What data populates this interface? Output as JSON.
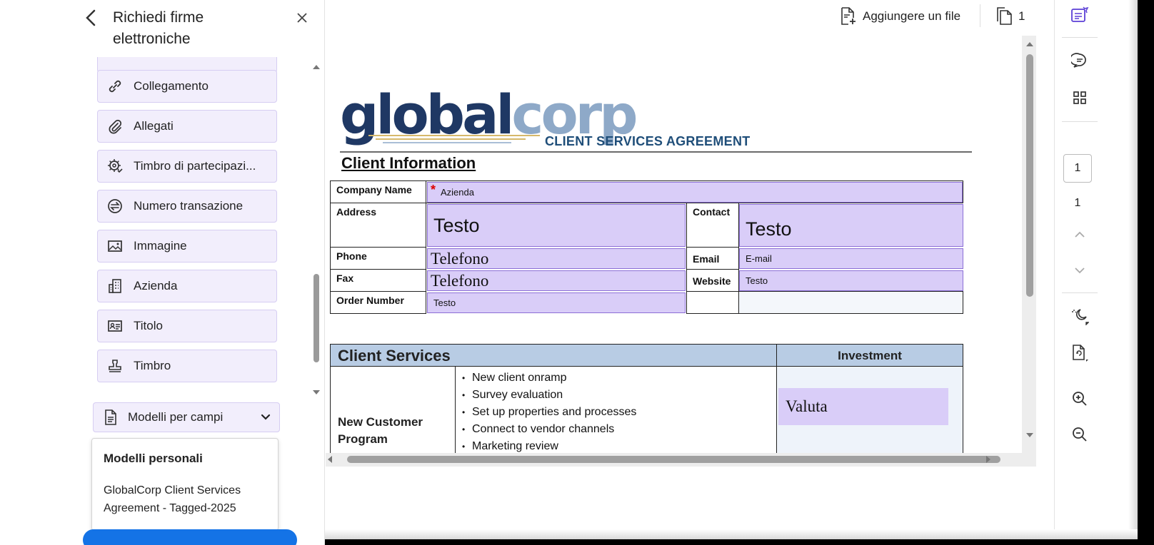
{
  "panel": {
    "title": "Richiedi firme elettroniche",
    "fields": [
      {
        "label": "Collegamento",
        "icon": "link-icon"
      },
      {
        "label": "Allegati",
        "icon": "paperclip-icon"
      },
      {
        "label": "Timbro di partecipazi...",
        "icon": "participation-stamp-icon"
      },
      {
        "label": "Numero transazione",
        "icon": "transaction-number-icon"
      },
      {
        "label": "Immagine",
        "icon": "image-icon"
      },
      {
        "label": "Azienda",
        "icon": "building-icon"
      },
      {
        "label": "Titolo",
        "icon": "id-card-icon"
      },
      {
        "label": "Timbro",
        "icon": "stamp-icon"
      }
    ],
    "templates_dropdown": "Modelli per campi",
    "templates_menu": {
      "header": "Modelli personali",
      "item": "GlobalCorp Client Services Agreement - Tagged-2025"
    }
  },
  "toolbar": {
    "add_file": "Aggiungere un file",
    "page_count": "1"
  },
  "document": {
    "logo_global": "global",
    "logo_corp": "corp",
    "title": "CLIENT SERVICES AGREEMENT",
    "section_client_info": "Client Information",
    "labels": {
      "company_name": "Company Name",
      "address": "Address",
      "contact": "Contact",
      "phone": "Phone",
      "email": "Email",
      "fax": "Fax",
      "website": "Website",
      "order_number": "Order Number"
    },
    "fields": {
      "company": "Azienda",
      "address": "Testo",
      "contact": "Testo",
      "phone": "Telefono",
      "email": "E-mail",
      "fax": "Telefono",
      "website": "Testo",
      "order_number": "Testo",
      "investment": "Valuta"
    },
    "section_client_services": "Client Services",
    "investment_header": "Investment",
    "program_label": "New Customer Program",
    "bullets": [
      "New client onramp",
      "Survey evaluation",
      "Set up properties and processes",
      "Connect to vendor channels",
      "Marketing review"
    ]
  },
  "rail": {
    "page_current": "1",
    "page_total": "1"
  },
  "colors": {
    "field_fill": "#d9cdf8",
    "field_border": "#8c6fd6",
    "panel_item_fill": "#f2eefc",
    "table_header": "#b8cce4",
    "accent_blue": "#1473e6"
  }
}
